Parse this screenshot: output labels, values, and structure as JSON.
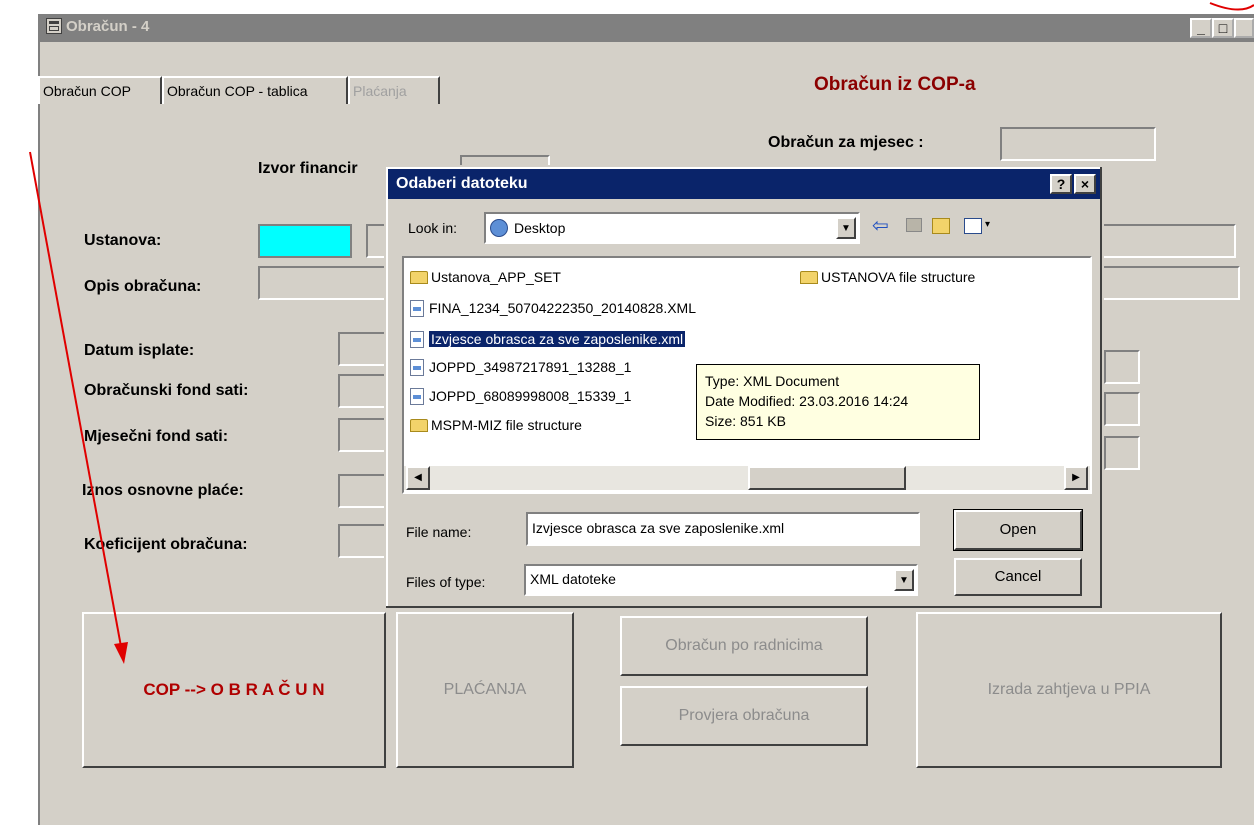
{
  "window": {
    "title": "Obračun - 4"
  },
  "tabs": [
    {
      "label": "Obračun COP"
    },
    {
      "label": "Obračun COP - tablica"
    },
    {
      "label": "Plaćanja"
    }
  ],
  "heading": "Obračun iz COP-a",
  "labels": {
    "obracun_mjesec": "Obračun za mjesec :",
    "izvor": "Izvor financir",
    "ustanova": "Ustanova:",
    "opis": "Opis obračuna:",
    "datum": "Datum isplate:",
    "obr_fond": "Obračunski fond sati:",
    "mj_fond": "Mjesečni fond sati:",
    "iznos": "Iznos osnovne plaće:",
    "koef": "Koeficijent obračuna:"
  },
  "buttons": {
    "cop": "COP --> O B R A Č U N",
    "placanja": "PLAĆANJA",
    "po_radnicima": "Obračun po radnicima",
    "provjera": "Provjera obračuna",
    "izrada": "Izrada zahtjeva u PPIA"
  },
  "dialog": {
    "title": "Odaberi datoteku",
    "look_in_label": "Look in:",
    "look_in_value": "Desktop",
    "files": [
      {
        "name": "Ustanova_APP_SET",
        "kind": "folder"
      },
      {
        "name": "FINA_1234_50704222350_20140828.XML",
        "kind": "xml"
      },
      {
        "name": "Izvjesce obrasca za sve zaposlenike.xml",
        "kind": "xml",
        "selected": true
      },
      {
        "name": "JOPPD_34987217891_13288_1",
        "kind": "xml"
      },
      {
        "name": "JOPPD_68089998008_15339_1",
        "kind": "xml"
      },
      {
        "name": "MSPM-MIZ file structure",
        "kind": "shared-folder"
      },
      {
        "name": "USTANOVA file structure",
        "kind": "shared-folder"
      }
    ],
    "tooltip": {
      "type": "Type: XML Document",
      "modified": "Date Modified: 23.03.2016 14:24",
      "size": "Size: 851 KB"
    },
    "file_name_label": "File name:",
    "file_name_value": "Izvjesce obrasca za sve zaposlenike.xml",
    "files_type_label": "Files of type:",
    "files_type_value": "XML datoteke",
    "open_label": "Open",
    "cancel_label": "Cancel",
    "help_label": "?",
    "close_label": "×"
  },
  "colors": {
    "accent_red": "#8b0000",
    "dialog_title": "#0a246a",
    "ustanova_field": "#00ffff",
    "tooltip_bg": "#ffffe1",
    "annotation": "#e00000"
  }
}
